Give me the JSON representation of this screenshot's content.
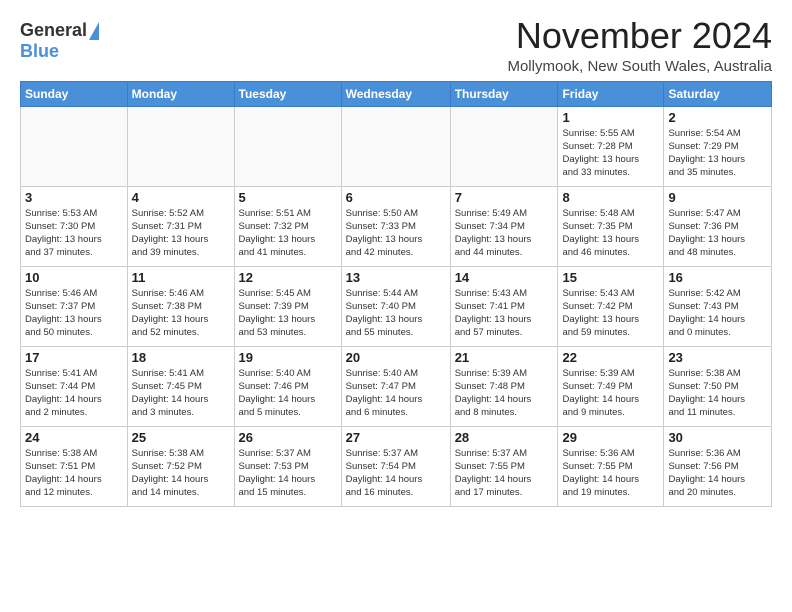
{
  "header": {
    "logo_general": "General",
    "logo_blue": "Blue",
    "month_title": "November 2024",
    "subtitle": "Mollymook, New South Wales, Australia"
  },
  "days_of_week": [
    "Sunday",
    "Monday",
    "Tuesday",
    "Wednesday",
    "Thursday",
    "Friday",
    "Saturday"
  ],
  "weeks": [
    [
      {
        "day": "",
        "info": ""
      },
      {
        "day": "",
        "info": ""
      },
      {
        "day": "",
        "info": ""
      },
      {
        "day": "",
        "info": ""
      },
      {
        "day": "",
        "info": ""
      },
      {
        "day": "1",
        "info": "Sunrise: 5:55 AM\nSunset: 7:28 PM\nDaylight: 13 hours\nand 33 minutes."
      },
      {
        "day": "2",
        "info": "Sunrise: 5:54 AM\nSunset: 7:29 PM\nDaylight: 13 hours\nand 35 minutes."
      }
    ],
    [
      {
        "day": "3",
        "info": "Sunrise: 5:53 AM\nSunset: 7:30 PM\nDaylight: 13 hours\nand 37 minutes."
      },
      {
        "day": "4",
        "info": "Sunrise: 5:52 AM\nSunset: 7:31 PM\nDaylight: 13 hours\nand 39 minutes."
      },
      {
        "day": "5",
        "info": "Sunrise: 5:51 AM\nSunset: 7:32 PM\nDaylight: 13 hours\nand 41 minutes."
      },
      {
        "day": "6",
        "info": "Sunrise: 5:50 AM\nSunset: 7:33 PM\nDaylight: 13 hours\nand 42 minutes."
      },
      {
        "day": "7",
        "info": "Sunrise: 5:49 AM\nSunset: 7:34 PM\nDaylight: 13 hours\nand 44 minutes."
      },
      {
        "day": "8",
        "info": "Sunrise: 5:48 AM\nSunset: 7:35 PM\nDaylight: 13 hours\nand 46 minutes."
      },
      {
        "day": "9",
        "info": "Sunrise: 5:47 AM\nSunset: 7:36 PM\nDaylight: 13 hours\nand 48 minutes."
      }
    ],
    [
      {
        "day": "10",
        "info": "Sunrise: 5:46 AM\nSunset: 7:37 PM\nDaylight: 13 hours\nand 50 minutes."
      },
      {
        "day": "11",
        "info": "Sunrise: 5:46 AM\nSunset: 7:38 PM\nDaylight: 13 hours\nand 52 minutes."
      },
      {
        "day": "12",
        "info": "Sunrise: 5:45 AM\nSunset: 7:39 PM\nDaylight: 13 hours\nand 53 minutes."
      },
      {
        "day": "13",
        "info": "Sunrise: 5:44 AM\nSunset: 7:40 PM\nDaylight: 13 hours\nand 55 minutes."
      },
      {
        "day": "14",
        "info": "Sunrise: 5:43 AM\nSunset: 7:41 PM\nDaylight: 13 hours\nand 57 minutes."
      },
      {
        "day": "15",
        "info": "Sunrise: 5:43 AM\nSunset: 7:42 PM\nDaylight: 13 hours\nand 59 minutes."
      },
      {
        "day": "16",
        "info": "Sunrise: 5:42 AM\nSunset: 7:43 PM\nDaylight: 14 hours\nand 0 minutes."
      }
    ],
    [
      {
        "day": "17",
        "info": "Sunrise: 5:41 AM\nSunset: 7:44 PM\nDaylight: 14 hours\nand 2 minutes."
      },
      {
        "day": "18",
        "info": "Sunrise: 5:41 AM\nSunset: 7:45 PM\nDaylight: 14 hours\nand 3 minutes."
      },
      {
        "day": "19",
        "info": "Sunrise: 5:40 AM\nSunset: 7:46 PM\nDaylight: 14 hours\nand 5 minutes."
      },
      {
        "day": "20",
        "info": "Sunrise: 5:40 AM\nSunset: 7:47 PM\nDaylight: 14 hours\nand 6 minutes."
      },
      {
        "day": "21",
        "info": "Sunrise: 5:39 AM\nSunset: 7:48 PM\nDaylight: 14 hours\nand 8 minutes."
      },
      {
        "day": "22",
        "info": "Sunrise: 5:39 AM\nSunset: 7:49 PM\nDaylight: 14 hours\nand 9 minutes."
      },
      {
        "day": "23",
        "info": "Sunrise: 5:38 AM\nSunset: 7:50 PM\nDaylight: 14 hours\nand 11 minutes."
      }
    ],
    [
      {
        "day": "24",
        "info": "Sunrise: 5:38 AM\nSunset: 7:51 PM\nDaylight: 14 hours\nand 12 minutes."
      },
      {
        "day": "25",
        "info": "Sunrise: 5:38 AM\nSunset: 7:52 PM\nDaylight: 14 hours\nand 14 minutes."
      },
      {
        "day": "26",
        "info": "Sunrise: 5:37 AM\nSunset: 7:53 PM\nDaylight: 14 hours\nand 15 minutes."
      },
      {
        "day": "27",
        "info": "Sunrise: 5:37 AM\nSunset: 7:54 PM\nDaylight: 14 hours\nand 16 minutes."
      },
      {
        "day": "28",
        "info": "Sunrise: 5:37 AM\nSunset: 7:55 PM\nDaylight: 14 hours\nand 17 minutes."
      },
      {
        "day": "29",
        "info": "Sunrise: 5:36 AM\nSunset: 7:55 PM\nDaylight: 14 hours\nand 19 minutes."
      },
      {
        "day": "30",
        "info": "Sunrise: 5:36 AM\nSunset: 7:56 PM\nDaylight: 14 hours\nand 20 minutes."
      }
    ]
  ]
}
